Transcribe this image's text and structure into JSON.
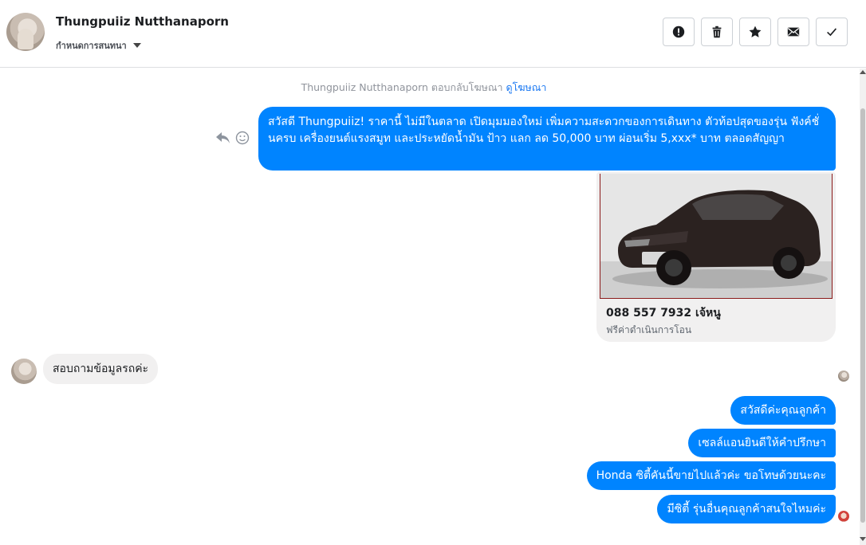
{
  "header": {
    "contact_name": "Thungpuiiz Nutthanaporn",
    "settings_label": "กำหนดการสนทนา",
    "actions": [
      {
        "name": "report-button",
        "icon": "exclamation-icon"
      },
      {
        "name": "delete-button",
        "icon": "trash-icon"
      },
      {
        "name": "star-button",
        "icon": "star-icon"
      },
      {
        "name": "mark-unread-button",
        "icon": "envelope-icon"
      },
      {
        "name": "mark-done-button",
        "icon": "check-icon"
      }
    ]
  },
  "thread": {
    "ad_reply_note": "Thungpuiiz Nutthanaporn ตอบกลับโฆษณา",
    "view_ad_link": "ดูโฆษณา",
    "ad_message": "สวัสดี Thungpuiiz! ราคานี้ ไม่มีในตลาด เปิดมุมมองใหม่ เพิ่มความสะดวกของการเดินทาง ตัวท้อปสุดของรุ่น ฟังค์ชั่นครบ เครื่องยนต์แรงสมูท และประหยัดน้ำมัน ป้าว แลก ลด 50,000 บาท ผ่อนเริ่ม 5,xxx* บาท ตลอดสัญญา",
    "ad_card": {
      "title": "088 557 7932 เจ้หนู",
      "subtitle": "ฟรีค่าดำเนินการโอน",
      "image": "silver-sedan-car-photo"
    },
    "incoming_message": "สอบถามข้อมูลรถค่ะ",
    "outgoing_messages": [
      "สวัสดีค่ะคุณลูกค้า",
      "เซลล์แอนยินดีให้คำปรึกษา",
      "Honda ซิตี้คันนี้ขายไปแล้วค่ะ ขอโทษด้วยนะคะ",
      "มีซิตี้ รุ่นอื่นคุณลูกค้าสนใจไหมค่ะ"
    ]
  },
  "colors": {
    "outgoing_bubble": "#0084ff",
    "incoming_bubble": "#f1f0f0",
    "link": "#1877f2"
  }
}
